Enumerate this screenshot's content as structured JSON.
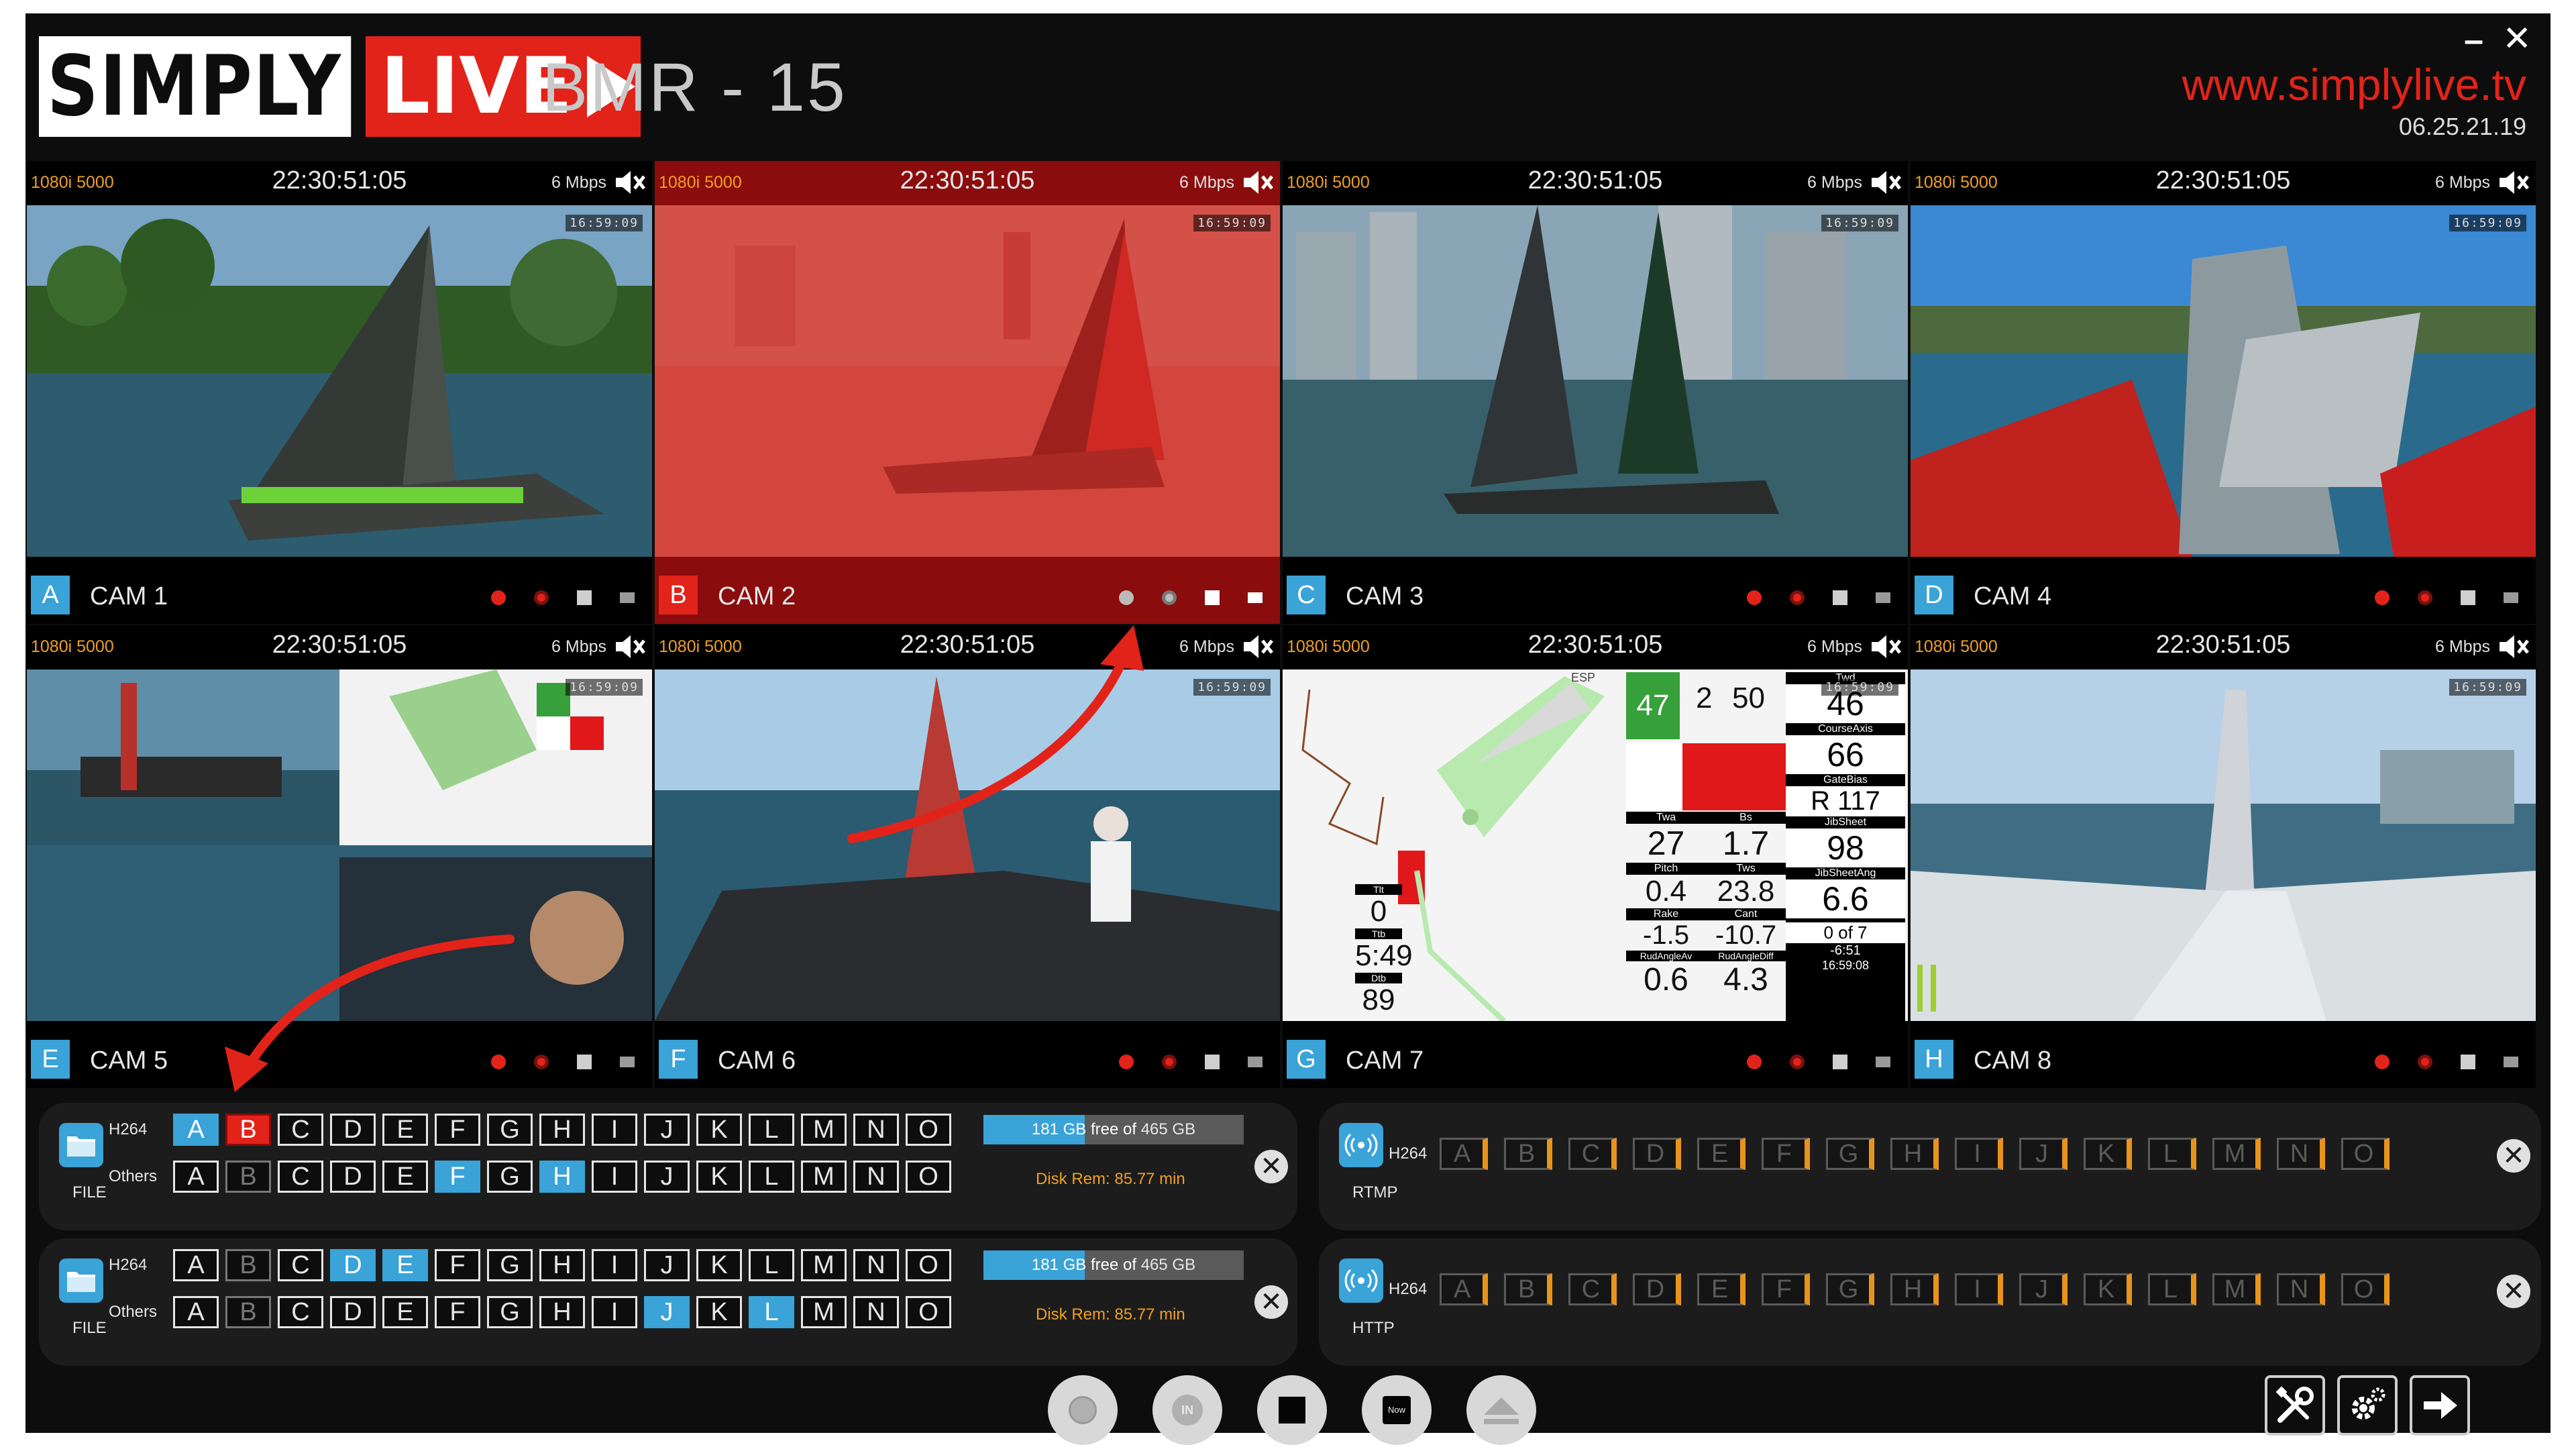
{
  "header": {
    "logo_simply": "SIMPLY",
    "logo_live": "LIVE",
    "app_title": "BMR - 15",
    "website": "www.simplylive.tv",
    "version": "06.25.21.19",
    "minimize": "–",
    "close": "✕"
  },
  "cameras": [
    {
      "letter": "A",
      "name": "CAM 1",
      "format": "1080i 5000",
      "timecode": "22:30:51:05",
      "bitrate": "6 Mbps"
    },
    {
      "letter": "B",
      "name": "CAM 2",
      "format": "1080i 5000",
      "timecode": "22:30:51:05",
      "bitrate": "6 Mbps",
      "selected": true
    },
    {
      "letter": "C",
      "name": "CAM 3",
      "format": "1080i 5000",
      "timecode": "22:30:51:05",
      "bitrate": "6 Mbps"
    },
    {
      "letter": "D",
      "name": "CAM 4",
      "format": "1080i 5000",
      "timecode": "22:30:51:05",
      "bitrate": "6 Mbps"
    },
    {
      "letter": "E",
      "name": "CAM 5",
      "format": "1080i 5000",
      "timecode": "22:30:51:05",
      "bitrate": "6 Mbps"
    },
    {
      "letter": "F",
      "name": "CAM 6",
      "format": "1080i 5000",
      "timecode": "22:30:51:05",
      "bitrate": "6 Mbps"
    },
    {
      "letter": "G",
      "name": "CAM 7",
      "format": "1080i 5000",
      "timecode": "22:30:51:05",
      "bitrate": "6 Mbps"
    },
    {
      "letter": "H",
      "name": "CAM 8",
      "format": "1080i 5000",
      "timecode": "22:30:51:05",
      "bitrate": "6 Mbps"
    }
  ],
  "video_overlay_tc": "16:59:09",
  "telemetry": {
    "twd_label": "Twd",
    "twd": "46",
    "course_axis_label": "CourseAxis",
    "course_axis": "66",
    "gate_bias_label": "GateBias",
    "gate_bias": "R 117",
    "jib_sheet_label": "JibSheet",
    "jib_sheet": "98",
    "jib_sheet_ang_label": "JibSheetAng",
    "jib_sheet_ang": "6.6",
    "twa_label": "Twa",
    "twa": "27",
    "bs_label": "Bs",
    "bs": "1.7",
    "pitch_label": "Pitch",
    "pitch": "0.4",
    "tws_label": "Tws",
    "tws": "23.8",
    "rake_label": "Rake",
    "rake": "-1.5",
    "cant_label": "Cant",
    "cant": "-10.7",
    "rud_av_label": "RudAngleAv",
    "rud_av": "0.6",
    "rud_diff_label": "RudAngleDiff",
    "rud_diff": "4.3",
    "left_top": "47",
    "hdg": "2",
    "bstrgt": "50",
    "tilt_label": "Tlt",
    "tilt": "0",
    "ttb_label": "Ttb",
    "ttb": "5:49",
    "dtb_label": "Dtb",
    "dtb": "89",
    "lap": "0 of 7",
    "delta": "-6:51",
    "clock": "16:59:08",
    "esp": "ESP"
  },
  "panels": {
    "file1": {
      "type": "FILE",
      "h264_label": "H264",
      "others_label": "Others",
      "disk_free": "181 GB free of",
      "disk_total": "465 GB",
      "disk_free_fraction": 0.39,
      "disk_rem": "Disk Rem: 85.77 min",
      "h264": [
        {
          "l": "A",
          "s": "on"
        },
        {
          "l": "B",
          "s": "red"
        },
        {
          "l": "C",
          "s": ""
        },
        {
          "l": "D",
          "s": ""
        },
        {
          "l": "E",
          "s": ""
        },
        {
          "l": "F",
          "s": ""
        },
        {
          "l": "G",
          "s": ""
        },
        {
          "l": "H",
          "s": ""
        },
        {
          "l": "I",
          "s": ""
        },
        {
          "l": "J",
          "s": ""
        },
        {
          "l": "K",
          "s": ""
        },
        {
          "l": "L",
          "s": ""
        },
        {
          "l": "M",
          "s": ""
        },
        {
          "l": "N",
          "s": ""
        },
        {
          "l": "O",
          "s": ""
        }
      ],
      "others": [
        {
          "l": "A",
          "s": ""
        },
        {
          "l": "B",
          "s": "dim"
        },
        {
          "l": "C",
          "s": ""
        },
        {
          "l": "D",
          "s": ""
        },
        {
          "l": "E",
          "s": ""
        },
        {
          "l": "F",
          "s": "on"
        },
        {
          "l": "G",
          "s": ""
        },
        {
          "l": "H",
          "s": "on"
        },
        {
          "l": "I",
          "s": ""
        },
        {
          "l": "J",
          "s": ""
        },
        {
          "l": "K",
          "s": ""
        },
        {
          "l": "L",
          "s": ""
        },
        {
          "l": "M",
          "s": ""
        },
        {
          "l": "N",
          "s": ""
        },
        {
          "l": "O",
          "s": ""
        }
      ]
    },
    "file2": {
      "type": "FILE",
      "h264_label": "H264",
      "others_label": "Others",
      "disk_free": "181 GB free of",
      "disk_total": "465 GB",
      "disk_free_fraction": 0.39,
      "disk_rem": "Disk Rem: 85.77 min",
      "h264": [
        {
          "l": "A",
          "s": ""
        },
        {
          "l": "B",
          "s": "dim"
        },
        {
          "l": "C",
          "s": ""
        },
        {
          "l": "D",
          "s": "on"
        },
        {
          "l": "E",
          "s": "on"
        },
        {
          "l": "F",
          "s": ""
        },
        {
          "l": "G",
          "s": ""
        },
        {
          "l": "H",
          "s": ""
        },
        {
          "l": "I",
          "s": ""
        },
        {
          "l": "J",
          "s": ""
        },
        {
          "l": "K",
          "s": ""
        },
        {
          "l": "L",
          "s": ""
        },
        {
          "l": "M",
          "s": ""
        },
        {
          "l": "N",
          "s": ""
        },
        {
          "l": "O",
          "s": ""
        }
      ],
      "others": [
        {
          "l": "A",
          "s": ""
        },
        {
          "l": "B",
          "s": "dim"
        },
        {
          "l": "C",
          "s": ""
        },
        {
          "l": "D",
          "s": ""
        },
        {
          "l": "E",
          "s": ""
        },
        {
          "l": "F",
          "s": ""
        },
        {
          "l": "G",
          "s": ""
        },
        {
          "l": "H",
          "s": ""
        },
        {
          "l": "I",
          "s": ""
        },
        {
          "l": "J",
          "s": "on"
        },
        {
          "l": "K",
          "s": ""
        },
        {
          "l": "L",
          "s": "on"
        },
        {
          "l": "M",
          "s": ""
        },
        {
          "l": "N",
          "s": ""
        },
        {
          "l": "O",
          "s": ""
        }
      ]
    },
    "rtmp": {
      "type": "RTMP",
      "h264_label": "H264",
      "h264": [
        "A",
        "B",
        "C",
        "D",
        "E",
        "F",
        "G",
        "H",
        "I",
        "J",
        "K",
        "L",
        "M",
        "N",
        "O"
      ]
    },
    "http": {
      "type": "HTTP",
      "h264_label": "H264",
      "h264": [
        "A",
        "B",
        "C",
        "D",
        "E",
        "F",
        "G",
        "H",
        "I",
        "J",
        "K",
        "L",
        "M",
        "N",
        "O"
      ]
    },
    "close_glyph": "✕"
  },
  "transport": {
    "in_label": "IN",
    "now_label": "Now"
  },
  "colors": {
    "accent_blue": "#3aa3d8",
    "brand_red": "#e2231a",
    "warning_orange": "#f0a020",
    "background": "#0d0d0d"
  }
}
